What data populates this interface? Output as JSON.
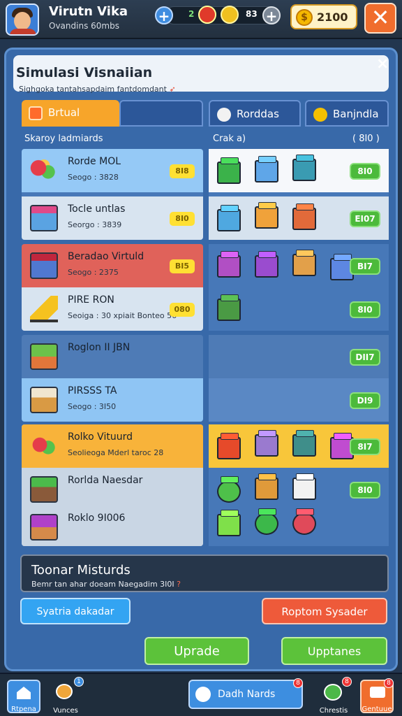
{
  "header": {
    "player_name": "Virutn Vika",
    "player_sub": "Ovandins 60mbs",
    "res1": "2",
    "res2": "83",
    "coins": "2100"
  },
  "panel": {
    "title": "Simulasi Visnaiian",
    "subtitle": "Sighgoka tantahsapdaim fantdomdant",
    "close": "×"
  },
  "tabs": [
    {
      "label": "Brtual"
    },
    {
      "label": ""
    },
    {
      "label": "Rorddas"
    },
    {
      "label": "Banjndla"
    }
  ],
  "columns": {
    "left": "Skaroy ladmiards",
    "right": "Crak a)",
    "right_count": "( 8I0 )"
  },
  "rows": [
    {
      "name": "Rorde MOL",
      "sub": "Seogo : 3828",
      "badge": "8I8"
    },
    {
      "name": "Tocle untlas",
      "sub": "Seorgo : 3839",
      "badge": "8I0"
    },
    {
      "name": "Beradao Virtuld",
      "sub": "Seogo : 2375",
      "badge": "BI5"
    },
    {
      "name": "PIRE RON",
      "sub": "Seoiga : 30 xpiait Bonteo 56",
      "badge": "080"
    },
    {
      "name": "Roglon II JBN",
      "sub": "",
      "badge": ""
    },
    {
      "name": "PIRSSS TA",
      "sub": "Seogo : 3I50",
      "badge": ""
    },
    {
      "name": "Rolko Vituurd",
      "sub": "Seolieoga Mderl taroc 28",
      "badge": ""
    },
    {
      "name": "Rorlda Naesdar",
      "sub": "",
      "badge": ""
    },
    {
      "name": "Roklo 9I006",
      "sub": "",
      "badge": ""
    }
  ],
  "grid_badges": [
    "8I0",
    "EI07",
    "BI7",
    "8I0",
    "DII7",
    "DI9",
    "8I7",
    "8I0"
  ],
  "toolbar": {
    "title": "Toonar Misturds",
    "sub": "Bemr tan ahar doeam Naegadim 3I0I"
  },
  "buttons": {
    "left": "Syatria dakadar",
    "right": "Roptom Sysader",
    "upgrade1": "Uprade",
    "upgrade2": "Upptanes"
  },
  "bottom_nav": [
    {
      "label": "Rtpena",
      "badge": ""
    },
    {
      "label": "Vunces",
      "badge": "1"
    },
    {
      "label": "Dadh Nards",
      "badge": "8"
    },
    {
      "label": "Chrestis",
      "badge": "8"
    },
    {
      "label": "Gentuue",
      "badge": "8"
    }
  ],
  "colors": {
    "accent": "#3869a9",
    "gold": "#ffe033",
    "green": "#4cba3b",
    "red": "#f06d2d"
  }
}
